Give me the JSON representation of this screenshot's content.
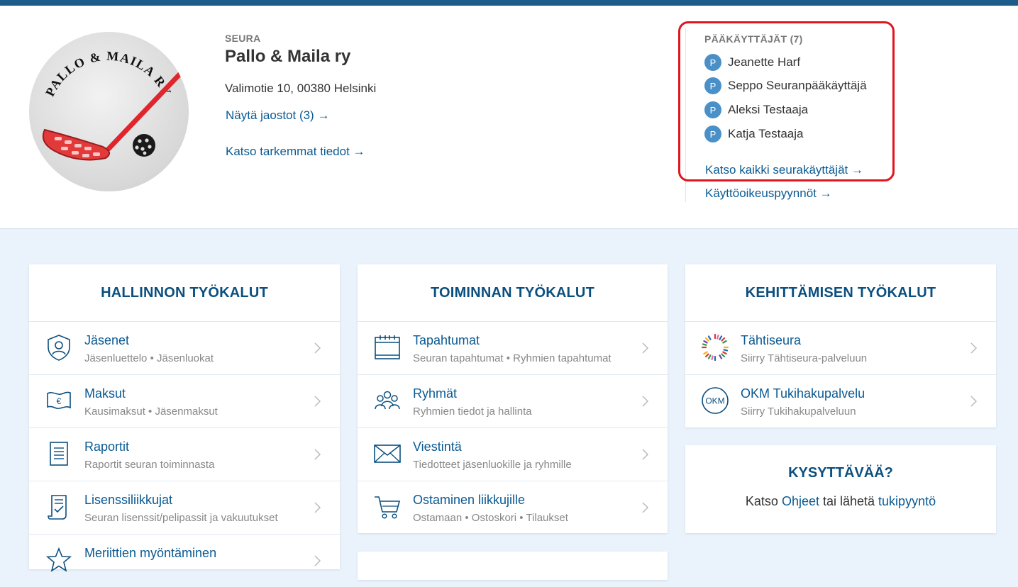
{
  "club": {
    "eyebrow": "SEURA",
    "name": "Pallo & Maila ry",
    "logo_text": "PALLO & MAILA RY",
    "address": "Valimotie 10, 00380 Helsinki",
    "sections_link": "Näytä jaostot (3) →",
    "details_link": "Katso tarkemmat tiedot →"
  },
  "admins": {
    "heading": "PÄÄKÄYTTÄJÄT (7)",
    "avatar_letter": "P",
    "users": [
      "Jeanette Harf",
      "Seppo Seuranpääkäyttäjä",
      "Aleksi Testaaja",
      "Katja Testaaja"
    ],
    "all_users_link": "Katso kaikki seurakäyttäjät →",
    "requests_link": "Käyttöoikeuspyynnöt →"
  },
  "cards": {
    "admin_tools": {
      "title": "HALLINNON TYÖKALUT",
      "items": [
        {
          "title": "Jäsenet",
          "subtitle": "Jäsenluettelo • Jäsenluokat",
          "icon": "shield-user-icon"
        },
        {
          "title": "Maksut",
          "subtitle": "Kausimaksut • Jäsenmaksut",
          "icon": "euro-banknote-icon"
        },
        {
          "title": "Raportit",
          "subtitle": "Raportit seuran toiminnasta",
          "icon": "document-icon"
        },
        {
          "title": "Lisenssiliikkujat",
          "subtitle": "Seuran lisenssit/pelipassit ja vakuutukset",
          "icon": "license-scroll-icon"
        },
        {
          "title": "Meriittien myöntäminen",
          "subtitle": "",
          "icon": "star-icon"
        }
      ]
    },
    "operation_tools": {
      "title": "TOIMINNAN TYÖKALUT",
      "items": [
        {
          "title": "Tapahtumat",
          "subtitle": "Seuran tapahtumat • Ryhmien tapahtumat",
          "icon": "calendar-icon"
        },
        {
          "title": "Ryhmät",
          "subtitle": "Ryhmien tiedot ja hallinta",
          "icon": "group-icon"
        },
        {
          "title": "Viestintä",
          "subtitle": "Tiedotteet jäsenluokille ja ryhmille",
          "icon": "envelope-icon"
        },
        {
          "title": "Ostaminen liikkujille",
          "subtitle": "Ostamaan • Ostoskori • Tilaukset",
          "icon": "cart-icon"
        }
      ]
    },
    "development_tools": {
      "title": "KEHITTÄMISEN TYÖKALUT",
      "items": [
        {
          "title": "Tähtiseura",
          "subtitle": "Siirry Tähtiseura-palveluun",
          "icon": "tahtiseura-logo-icon"
        },
        {
          "title": "OKM Tukihakupalvelu",
          "subtitle": "Siirry Tukihakupalveluun",
          "icon": "okm-logo-icon",
          "icon_text": "OKM"
        }
      ]
    },
    "help": {
      "title": "KYSYTTÄVÄÄ?",
      "text_before": "Katso ",
      "link1": "Ohjeet",
      "text_middle": " tai lähetä ",
      "link2": "tukipyyntö"
    }
  },
  "colors": {
    "brand_dark": "#0b4f7f",
    "link": "#0a5a92",
    "avatar": "#4a90c8",
    "highlight": "#e0161f",
    "page_bg": "#eaf3fb"
  }
}
